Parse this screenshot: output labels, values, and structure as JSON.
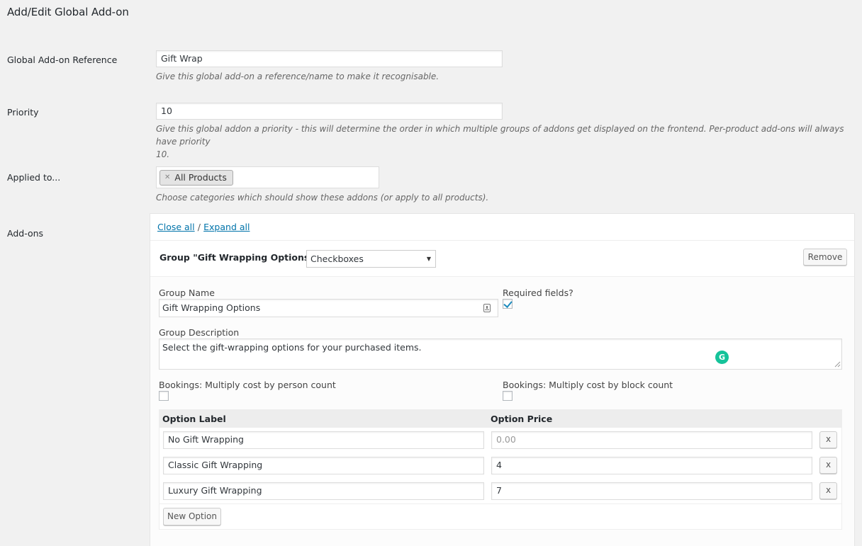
{
  "page_title": "Add/Edit Global Add-on",
  "reference": {
    "label": "Global Add-on Reference",
    "value": "Gift Wrap",
    "description": "Give this global add-on a reference/name to make it recognisable."
  },
  "priority": {
    "label": "Priority",
    "value": "10",
    "description_line1": "Give this global addon a priority - this will determine the order in which multiple groups of addons get displayed on the frontend. Per-product add-ons will always have priority",
    "description_line2": "10."
  },
  "applied_to": {
    "label": "Applied to...",
    "chips": [
      "All Products"
    ],
    "description": "Choose categories which should show these addons (or apply to all products)."
  },
  "addons": {
    "label": "Add-ons",
    "close_all": "Close all",
    "separator": "/",
    "expand_all": "Expand all",
    "group": {
      "title": "Group \"Gift Wrapping Options\"",
      "dash": "—",
      "type_select": "Checkboxes",
      "remove_label": "Remove",
      "name_label": "Group Name",
      "name_value": "Gift Wrapping Options",
      "required_label": "Required fields?",
      "required_checked": true,
      "description_label": "Group Description",
      "description_value": "Select the gift-wrapping options for your purchased items.",
      "bookings_person_label": "Bookings: Multiply cost by person count",
      "bookings_person_checked": false,
      "bookings_block_label": "Bookings: Multiply cost by block count",
      "bookings_block_checked": false,
      "option_label_header": "Option Label",
      "option_price_header": "Option Price",
      "options": [
        {
          "label": "No Gift Wrapping",
          "price": "",
          "price_placeholder": "0.00"
        },
        {
          "label": "Classic Gift Wrapping",
          "price": "4"
        },
        {
          "label": "Luxury Gift Wrapping",
          "price": "7"
        }
      ],
      "remove_option_label": "x",
      "new_option_label": "New Option"
    }
  },
  "colors": {
    "link": "#0073aa",
    "checkmark": "#1e8cbe",
    "grammarly": "#15c39a"
  }
}
